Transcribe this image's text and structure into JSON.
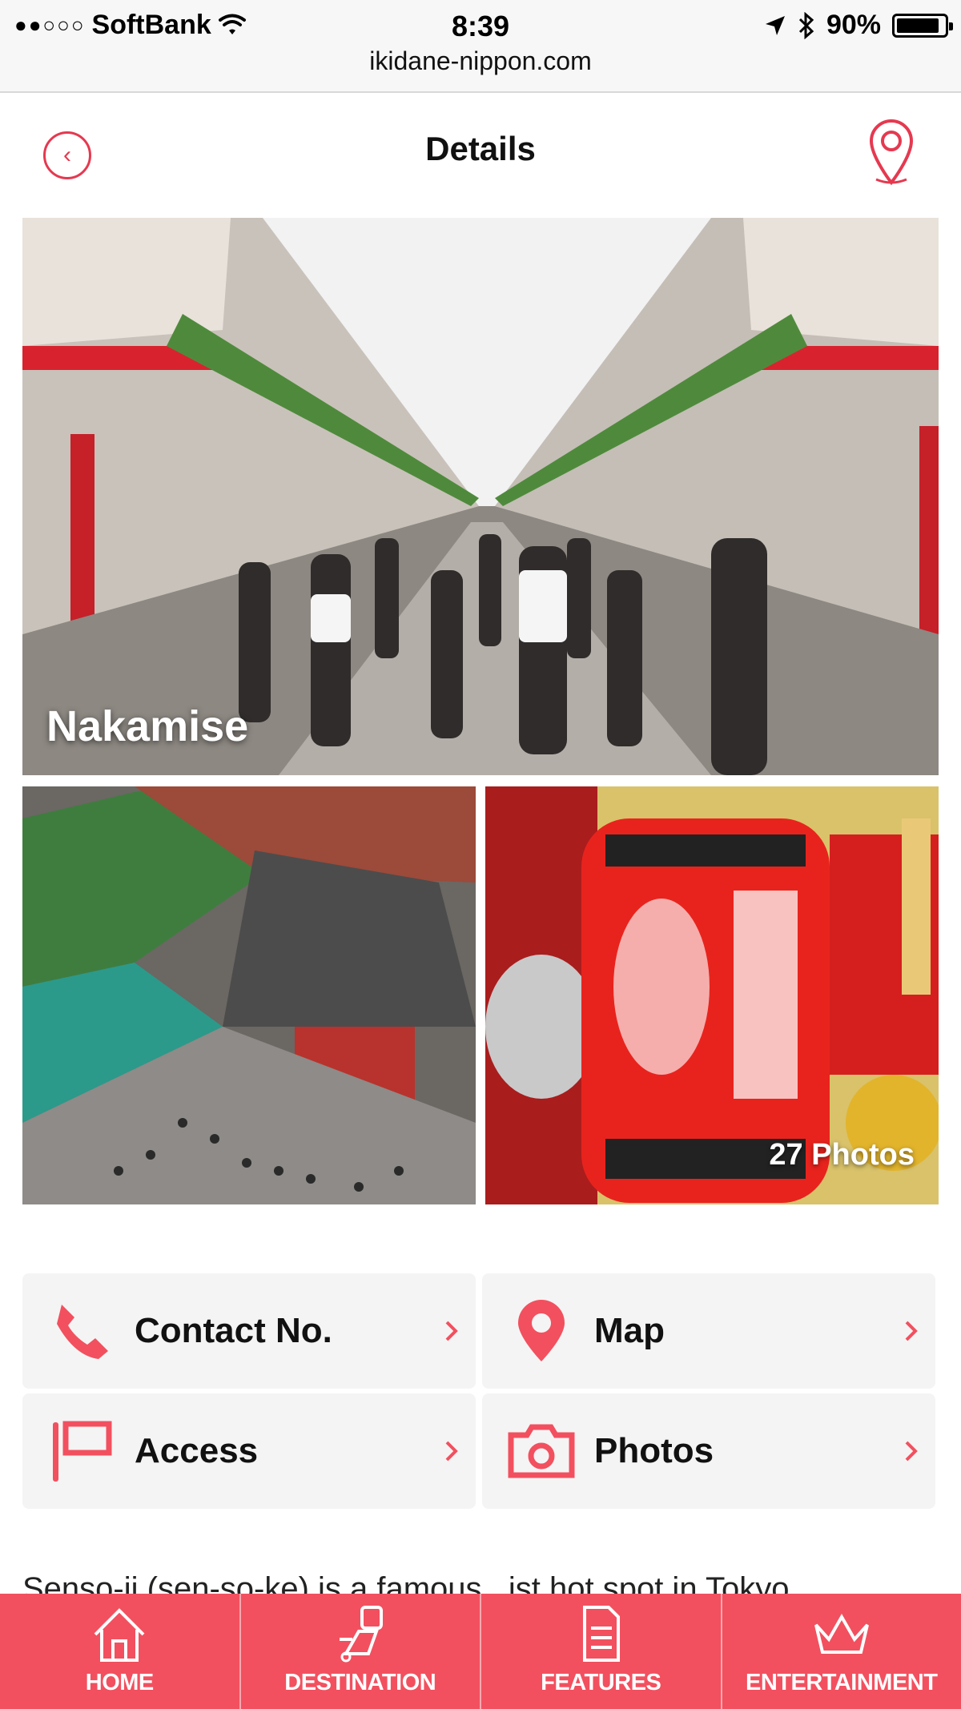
{
  "status_bar": {
    "carrier": "SoftBank",
    "signal_dots": "●●○○○",
    "time": "8:39",
    "battery": "90%",
    "battery_level": 0.9,
    "url": "ikidane-nippon.com"
  },
  "header": {
    "title": "Details",
    "back_icon": "chevron-left-icon",
    "map_icon": "map-pin-icon"
  },
  "gallery": {
    "hero_title": "Nakamise",
    "photos_count": "27 Photos"
  },
  "info_tiles": [
    {
      "label": "Contact No.",
      "icon": "phone-icon"
    },
    {
      "label": "Map",
      "icon": "map-pin-icon"
    },
    {
      "label": "Access",
      "icon": "flag-icon"
    },
    {
      "label": "Photos",
      "icon": "camera-icon"
    }
  ],
  "description_partial": "Senso-ji (sen-so-ke) is a famous...ist hot spot in Tokyo",
  "bottom_nav": [
    {
      "label": "HOME",
      "icon": "home-icon"
    },
    {
      "label": "DESTINATION",
      "icon": "map-icon"
    },
    {
      "label": "FEATURES",
      "icon": "document-icon"
    },
    {
      "label": "ENTERTAINMENT",
      "icon": "crown-icon"
    }
  ],
  "colors": {
    "accent": "#e53950",
    "nav_bg": "#f2505f",
    "tile_bg": "#f4f4f4"
  }
}
